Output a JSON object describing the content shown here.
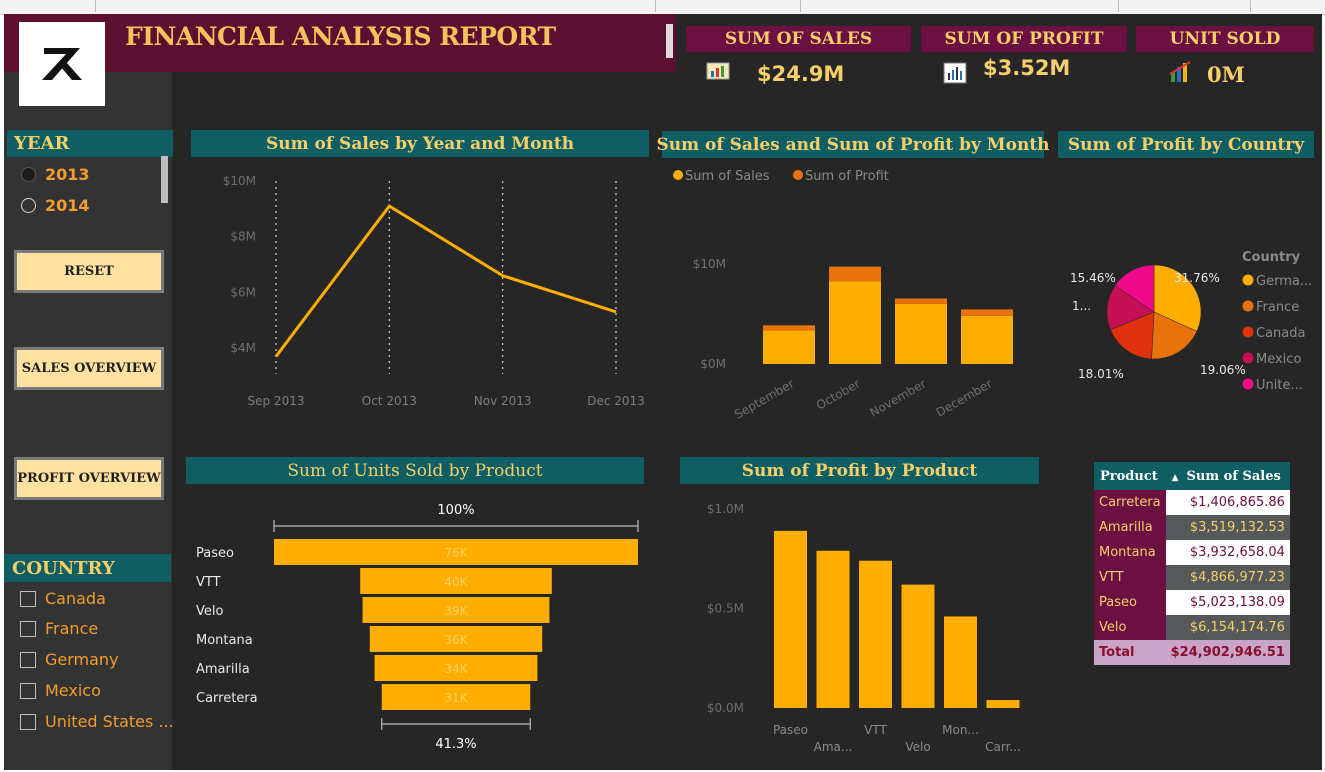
{
  "title": "FINANCIAL ANALYSIS REPORT",
  "kpis": {
    "sales": {
      "label": "SUM OF SALES",
      "value": "$24.9M"
    },
    "profit": {
      "label": "SUM OF PROFIT",
      "value": "$3.52M"
    },
    "units": {
      "label": "UNIT SOLD",
      "value": "0M"
    }
  },
  "year_filter": {
    "title": "YEAR",
    "options": [
      "2013",
      "2014"
    ],
    "selected": "2013"
  },
  "buttons": {
    "reset": "RESET",
    "sales_overview": "SALES OVERVIEW",
    "profit_overview": "PROFIT OVERVIEW"
  },
  "country_filter": {
    "title": "COUNTRY",
    "options": [
      "Canada",
      "France",
      "Germany",
      "Mexico",
      "United States ..."
    ]
  },
  "colors": {
    "accent": "#ffae00",
    "profit": "#e8730c",
    "teal": "#0e5e63",
    "maroon": "#6b1040",
    "gold": "#f6cf6a"
  },
  "charts": {
    "sales_by_month": {
      "title": "Sum of Sales by Year and Month",
      "type": "line",
      "x": [
        "Sep 2013",
        "Oct 2013",
        "Nov 2013",
        "Dec 2013"
      ],
      "y": [
        3.7,
        9.1,
        6.6,
        5.3
      ],
      "yticks": [
        "$10M",
        "$8M",
        "$6M",
        "$4M"
      ],
      "ylim": [
        3.5,
        10
      ]
    },
    "sales_profit": {
      "title": "Sum of Sales and Sum of Profit by Month",
      "type": "bar",
      "legend": [
        "Sum of  Sales",
        "Sum of  Profit"
      ],
      "categories": [
        "September",
        "October",
        "November",
        "December"
      ],
      "sales": [
        3.7,
        9.1,
        6.6,
        5.3
      ],
      "profit": [
        0.55,
        1.6,
        0.6,
        0.7
      ],
      "yticks": [
        "$10M",
        "$0M"
      ],
      "ylim": [
        0,
        12
      ]
    },
    "profit_by_country": {
      "title": "Sum of Profit by Country",
      "type": "pie",
      "legend_title": "Country",
      "slices": [
        {
          "name": "Germa...",
          "value": 31.76,
          "label": "31.76%",
          "color": "#ffae00"
        },
        {
          "name": "France",
          "value": 19.06,
          "label": "19.06%",
          "color": "#e8730c"
        },
        {
          "name": "Canada",
          "value": 18.01,
          "label": "18.01%",
          "color": "#e0320f"
        },
        {
          "name": "Mexico",
          "value": 15.71,
          "label": "1...",
          "color": "#c40f55"
        },
        {
          "name": "Unite...",
          "value": 15.46,
          "label": "15.46%",
          "color": "#ee0a8a"
        }
      ]
    },
    "units_by_product": {
      "title": "Sum of Units Sold by Product",
      "type": "funnel",
      "top_label": "100%",
      "bottom_label": "41.3%",
      "categories": [
        "Paseo",
        "VTT",
        "Velo",
        "Montana",
        "Amarilla",
        "Carretera"
      ],
      "values": [
        76,
        40,
        39,
        36,
        34,
        31
      ],
      "labels": [
        "76K",
        "40K",
        "39K",
        "36K",
        "34K",
        "31K"
      ]
    },
    "profit_by_product": {
      "title": "Sum of Profit by Product",
      "type": "bar",
      "categories": [
        "Paseo",
        "Ama...",
        "VTT",
        "Velo",
        "Mon...",
        "Carr..."
      ],
      "values": [
        0.89,
        0.79,
        0.74,
        0.62,
        0.46,
        0.04
      ],
      "yticks": [
        "$1.0M",
        "$0.5M",
        "$0.0M"
      ],
      "ylim": [
        0,
        1.0
      ]
    }
  },
  "table": {
    "headers": [
      "Product",
      "Sum of Sales"
    ],
    "rows": [
      [
        "Carretera",
        "$1,406,865.86"
      ],
      [
        "Amarilla",
        "$3,519,132.53"
      ],
      [
        "Montana",
        "$3,932,658.04"
      ],
      [
        "VTT",
        "$4,866,977.23"
      ],
      [
        "Paseo",
        "$5,023,138.09"
      ],
      [
        "Velo",
        "$6,154,174.76"
      ]
    ],
    "total": [
      "Total",
      "$24,902,946.51"
    ]
  }
}
